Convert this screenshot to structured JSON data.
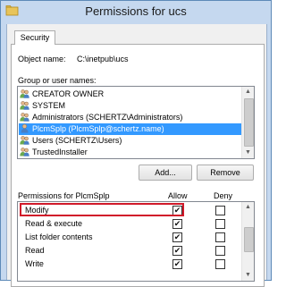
{
  "window": {
    "title": "Permissions for ucs"
  },
  "tabs": [
    {
      "label": "Security"
    }
  ],
  "object": {
    "label": "Object name:",
    "value": "C:\\inetpub\\ucs"
  },
  "group_list": {
    "label": "Group or user names:",
    "items": [
      {
        "label": "CREATOR OWNER",
        "icon": "users-group-icon",
        "selected": false
      },
      {
        "label": "SYSTEM",
        "icon": "users-group-icon",
        "selected": false
      },
      {
        "label": "Administrators (SCHERTZ\\Administrators)",
        "icon": "users-group-icon",
        "selected": false
      },
      {
        "label": "PlcmSplp (PlcmSplp@schertz.name)",
        "icon": "user-icon",
        "selected": true
      },
      {
        "label": "Users (SCHERTZ\\Users)",
        "icon": "users-group-icon",
        "selected": false
      },
      {
        "label": "TrustedInstaller",
        "icon": "users-group-icon",
        "selected": false
      }
    ]
  },
  "buttons": {
    "add": "Add...",
    "remove": "Remove"
  },
  "permissions": {
    "label": "Permissions for PlcmSplp",
    "allow_header": "Allow",
    "deny_header": "Deny",
    "rows": [
      {
        "name": "Modify",
        "allow": true,
        "deny": false,
        "highlighted": true
      },
      {
        "name": "Read & execute",
        "allow": true,
        "deny": false
      },
      {
        "name": "List folder contents",
        "allow": true,
        "deny": false
      },
      {
        "name": "Read",
        "allow": true,
        "deny": false
      },
      {
        "name": "Write",
        "allow": true,
        "deny": false
      }
    ]
  },
  "colors": {
    "selection": "#3399ff",
    "highlight_box": "#d11a2a",
    "title_bar": "#c5d8ef"
  }
}
